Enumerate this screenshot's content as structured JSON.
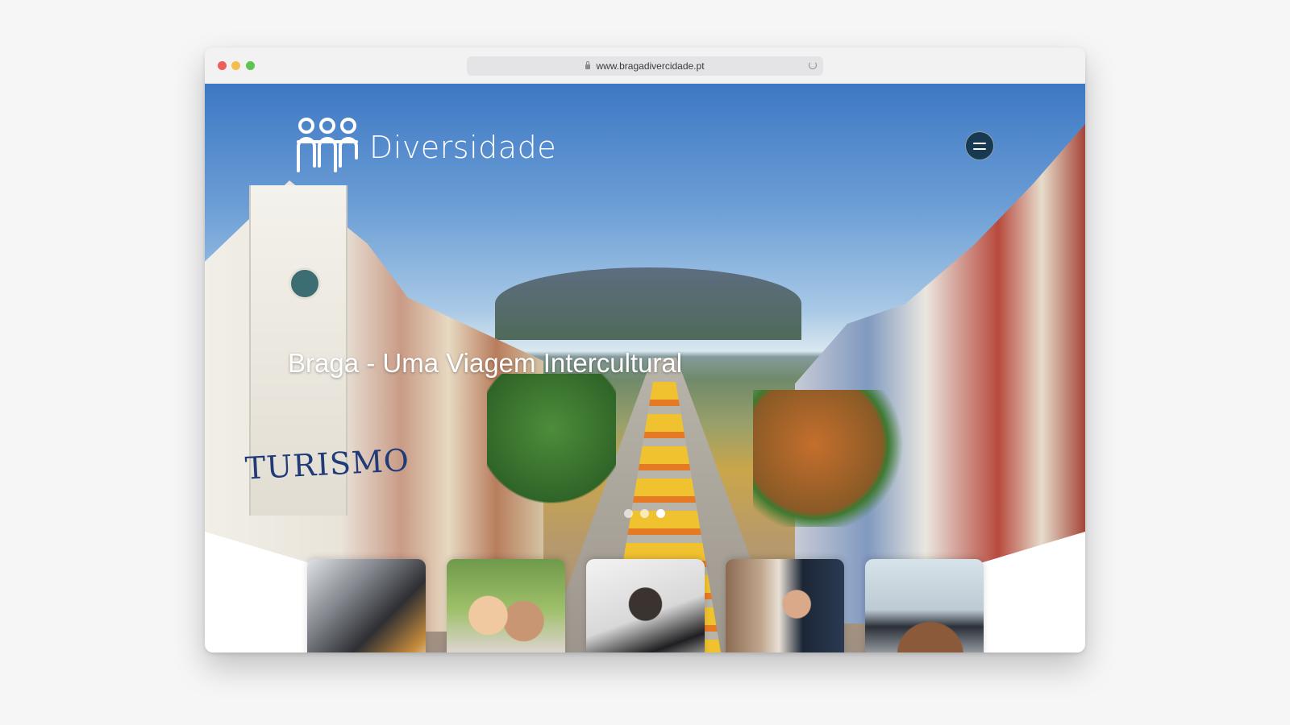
{
  "browser": {
    "url": "www.bragadivercidade.pt"
  },
  "site": {
    "logo_text": "Diversidade",
    "hero_title": "Braga - Uma Viagem Intercultural",
    "hero_scene_sign": "TURISMO",
    "slider": {
      "slides": 3,
      "active_index": 3
    },
    "cards": [
      {
        "label": "card-coffee"
      },
      {
        "label": "card-couple"
      },
      {
        "label": "card-woman-laptop"
      },
      {
        "label": "card-man-reading"
      },
      {
        "label": "card-woman-computer"
      }
    ]
  },
  "colors": {
    "menu_button_bg": "#173a52",
    "text_white": "#ffffff"
  }
}
